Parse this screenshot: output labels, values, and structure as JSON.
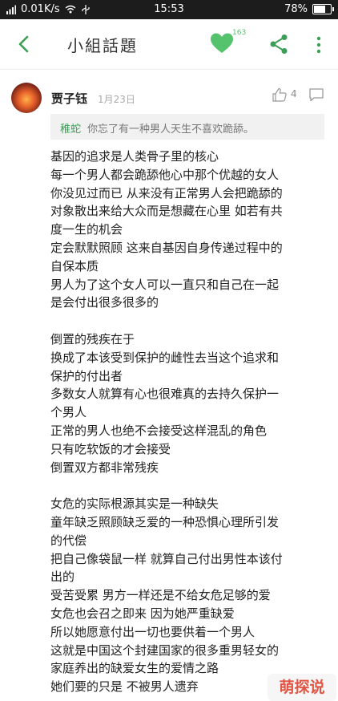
{
  "status_bar": {
    "net_speed": "0.01K/s",
    "time": "15:53",
    "battery": "78%",
    "battery_level": 0.78
  },
  "header": {
    "title": "小組話題",
    "like_count": "163"
  },
  "post": {
    "author": "贾子钰",
    "date": "1月23日",
    "like_count": "4",
    "quote": {
      "name": "稚蛇",
      "text": "你忘了有一种男人天生不喜欢跪舔。"
    },
    "lines": [
      "基因的追求是人类骨子里的核心",
      "每一个男人都会跪舔他心中那个优越的女人",
      "你没见过而已 从来没有正常男人会把跪舔的",
      "对象散出来给大众而是想藏在心里 如若有共",
      "度一生的机会",
      "定会默默照顾 这来自基因自身传递过程中的",
      "自保本质",
      "男人为了这个女人可以一直只和自己在一起",
      "是会付出很多很多的",
      "",
      "倒置的残疾在于",
      "换成了本该受到保护的雌性去当这个追求和",
      "保护的付出者",
      "多数女人就算有心也很难真的去持久保护一",
      "个男人",
      "正常的男人也绝不会接受这样混乱的角色",
      "只有吃软饭的才会接受",
      "倒置双方都非常残疾",
      "",
      "女危的实际根源其实是一种缺失",
      "童年缺乏照顾缺乏爱的一种恐惧心理所引发",
      "的代偿",
      "把自己像袋鼠一样 就算自己付出男性本该付",
      "出的",
      "受苦受累 男方一样还是不给女危足够的爱",
      "女危也会召之即来 因为她严重缺爱",
      "所以她愿意付出一切也要供着一个男人",
      "这就是中国这个封建国家的很多重男轻女的",
      "家庭养出的缺爱女生的爱情之路",
      "她们要的只是 不被男人遗弃"
    ]
  },
  "watermark": "萌探说",
  "colors": {
    "accent_green": "#55c36e",
    "status_bar_bg": "#1c1c1c",
    "watermark_red": "#e25545"
  }
}
